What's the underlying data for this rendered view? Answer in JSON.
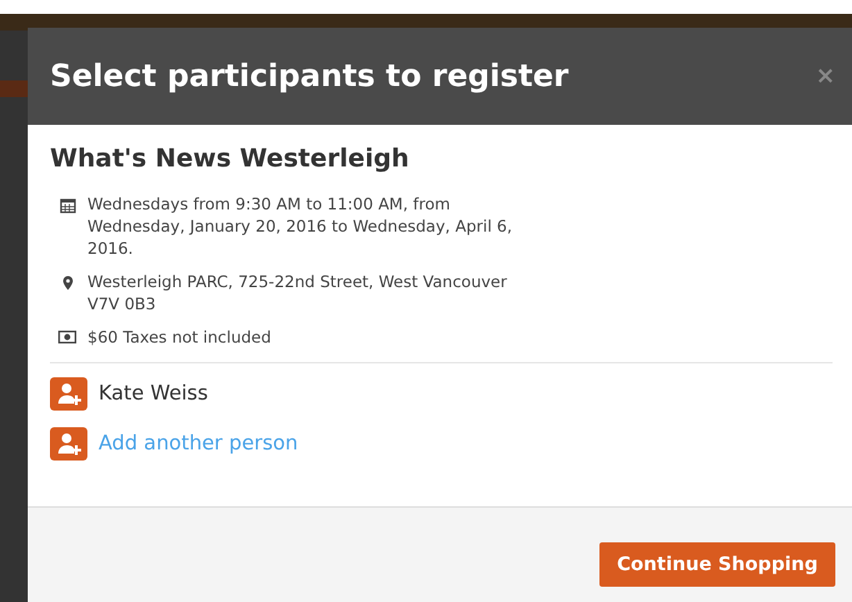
{
  "dialog": {
    "title": "Select participants to register",
    "close": "×"
  },
  "event": {
    "name": "What's News Westerleigh",
    "details": [
      {
        "kind": "schedule",
        "text": "Wednesdays from 9:30 AM to 11:00 AM, from Wednesday, January 20, 2016 to Wednesday, April 6, 2016."
      },
      {
        "kind": "location",
        "text": "Westerleigh PARC, 725-22nd Street, West Vancouver V7V 0B3"
      },
      {
        "kind": "price",
        "text": "$60 Taxes not included"
      }
    ]
  },
  "participants": [
    {
      "kind": "person",
      "name": "Kate Weiss"
    },
    {
      "kind": "add",
      "name": "Add another person"
    }
  ],
  "footer": {
    "button": "Continue Shopping"
  }
}
